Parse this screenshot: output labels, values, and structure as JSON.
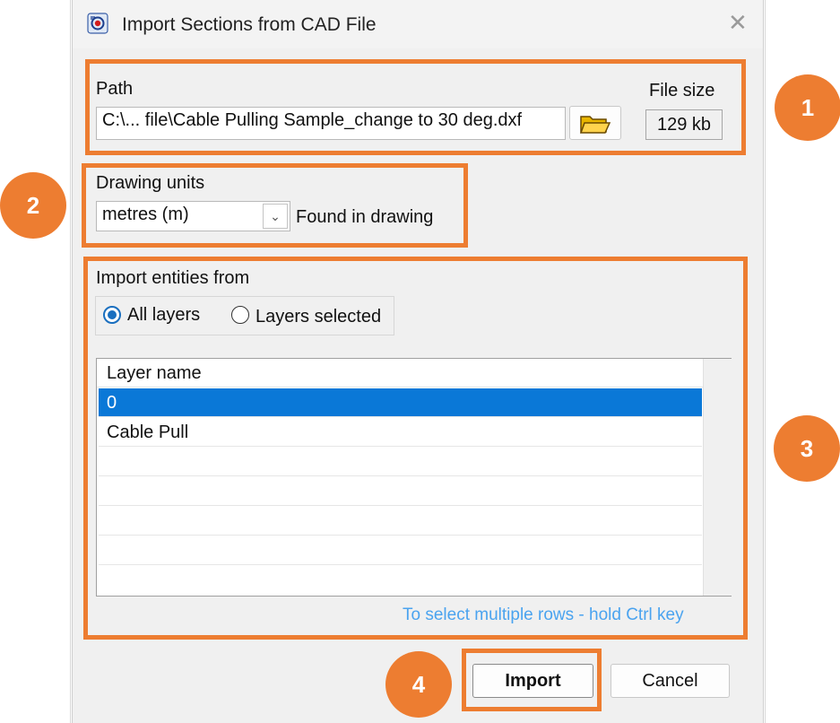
{
  "window": {
    "title": "Import Sections from CAD File",
    "close_label": "✕"
  },
  "path": {
    "label": "Path",
    "value": "C:\\... file\\Cable Pulling Sample_change to 30 deg.dxf",
    "browse_icon": "folder-open-icon"
  },
  "file_size": {
    "label": "File size",
    "value": "129 kb"
  },
  "units": {
    "label": "Drawing units",
    "selected": "metres (m)",
    "note": "Found in drawing"
  },
  "entities": {
    "label": "Import entities from",
    "options": [
      {
        "label": "All layers",
        "selected": true
      },
      {
        "label": "Layers selected",
        "selected": false
      }
    ]
  },
  "layers": {
    "header": "Layer name",
    "rows": [
      "0",
      "Cable Pull",
      "",
      "",
      "",
      "",
      ""
    ],
    "selected_index": 0
  },
  "hint": "To select multiple rows - hold Ctrl key",
  "buttons": {
    "import": "Import",
    "cancel": "Cancel"
  },
  "annotations": [
    "1",
    "2",
    "3",
    "4"
  ],
  "colors": {
    "annotation": "#ed7d31",
    "selection": "#0a78d7",
    "hint": "#4aa3ef"
  }
}
